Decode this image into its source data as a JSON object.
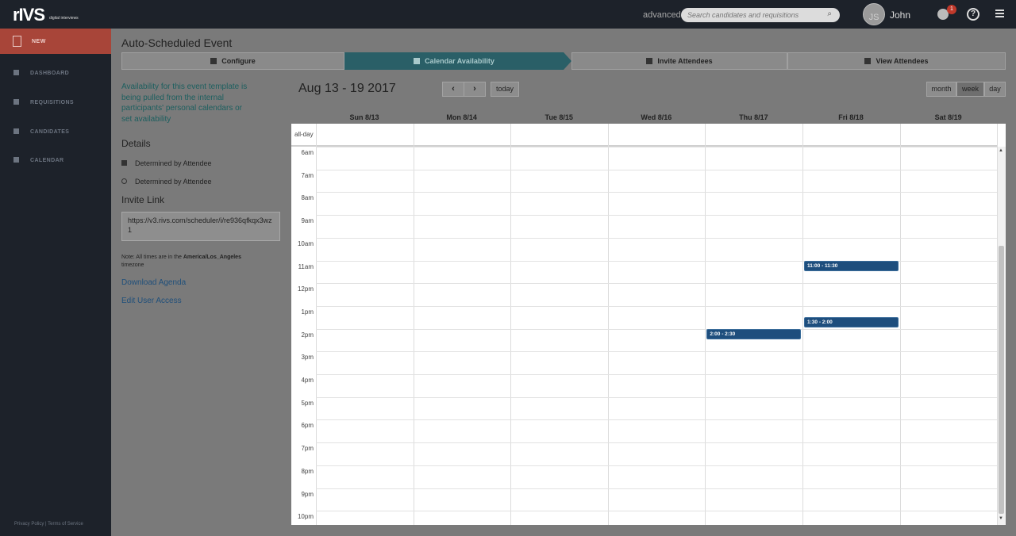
{
  "header": {
    "logo": "rIVS",
    "logo_sub": "digital interviews",
    "advanced_label": "advanced",
    "search_placeholder": "Search candidates and requisitions",
    "avatar_initials": "JS",
    "username": "John",
    "notification_count": "1"
  },
  "sidebar": {
    "new_label": "NEW",
    "items": [
      {
        "label": "DASHBOARD",
        "icon": "bar-chart-icon"
      },
      {
        "label": "REQUISITIONS",
        "icon": "document-icon"
      },
      {
        "label": "CANDIDATES",
        "icon": "people-icon"
      },
      {
        "label": "CALENDAR",
        "icon": "calendar-icon"
      }
    ],
    "footer": "Privacy Policy | Terms of Service"
  },
  "page": {
    "title": "Auto-Scheduled Event",
    "steps": [
      {
        "label": "Configure",
        "icon": "wrench-icon"
      },
      {
        "label": "Calendar Availability",
        "icon": "calendar-icon"
      },
      {
        "label": "Invite Attendees",
        "icon": "plus-icon"
      },
      {
        "label": "View Attendees",
        "icon": "person-icon"
      }
    ],
    "active_step": 1
  },
  "panel": {
    "availability_text": "Availability for this event template is being pulled from the internal participants' personal calendars or set availability",
    "details_title": "Details",
    "details": [
      "Determined by Attendee",
      "Determined by Attendee"
    ],
    "invite_title": "Invite Link",
    "invite_url": "https://v3.rivs.com/scheduler/i/re936qfkqx3wz1",
    "note_prefix": "Note: All times are in the",
    "note_tz": "America/Los_Angeles",
    "note_suffix": "timezone",
    "download_agenda": "Download Agenda",
    "edit_user_access": "Edit User Access"
  },
  "calendar": {
    "title": "Aug 13 - 19 2017",
    "prev": "‹",
    "next": "›",
    "today": "today",
    "views": [
      "month",
      "week",
      "day"
    ],
    "active_view": "week",
    "days": [
      "Sun 8/13",
      "Mon 8/14",
      "Tue 8/15",
      "Wed 8/16",
      "Thu 8/17",
      "Fri 8/18",
      "Sat 8/19"
    ],
    "allday_label": "all-day",
    "hours": [
      "6am",
      "7am",
      "8am",
      "9am",
      "10am",
      "11am",
      "12pm",
      "1pm",
      "2pm",
      "3pm",
      "4pm",
      "5pm",
      "6pm",
      "7pm",
      "8pm",
      "9pm",
      "10pm"
    ],
    "events": [
      {
        "label": "11:00 - 11:30",
        "day": "Fri 8/18",
        "start": "11:00",
        "end": "11:30"
      },
      {
        "label": "1:30 - 2:00",
        "day": "Fri 8/18",
        "start": "13:30",
        "end": "14:00"
      },
      {
        "label": "2:00 - 2:30",
        "day": "Thu 8/17",
        "start": "14:00",
        "end": "14:30"
      }
    ],
    "event_color": "#1e4e7d"
  }
}
